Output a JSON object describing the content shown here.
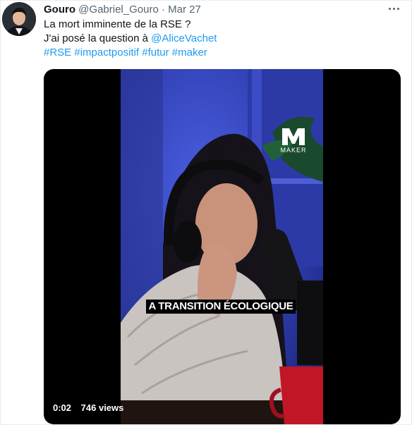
{
  "tweet": {
    "author_name": "Gouro",
    "author_handle": "@Gabriel_Gouro",
    "separator": "·",
    "date": "Mar 27",
    "line1": "La mort imminente de la RSE ?",
    "line2_prefix": "J'ai posé la question à ",
    "mention": "@AliceVachet",
    "hashtags": [
      "#RSE",
      "#impactpositif",
      "#futur",
      "#maker"
    ]
  },
  "video": {
    "caption": "A TRANSITION ÉCOLOGIQUE",
    "logo_text": "MAKER",
    "time": "0:02",
    "views": "746 views"
  },
  "colors": {
    "link": "#1d9bf0",
    "secondary_text": "#536471",
    "scene_blue": "#3d4fc6",
    "mug_red": "#c01626"
  }
}
